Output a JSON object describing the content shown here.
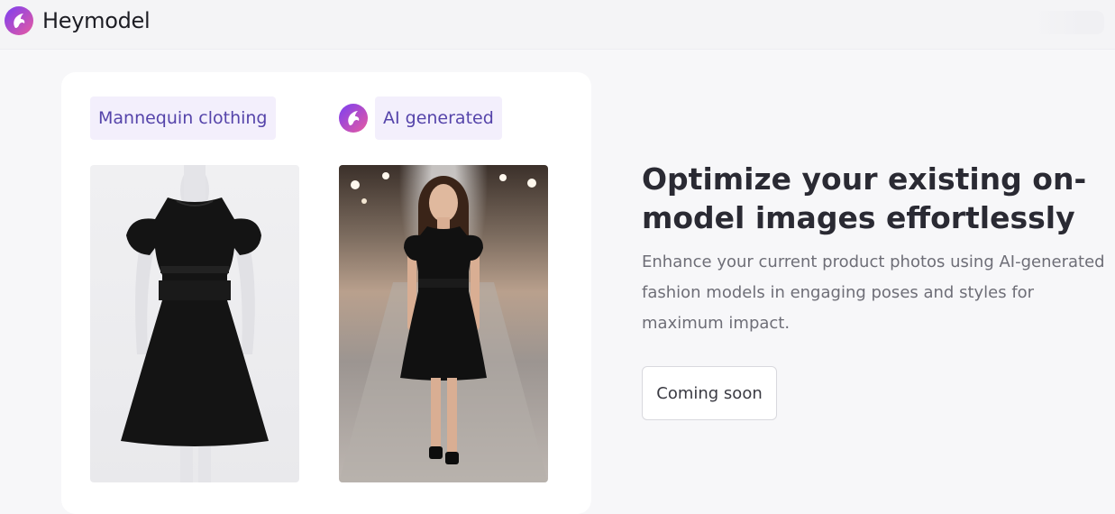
{
  "header": {
    "brand_name": "Heymodel",
    "logo_icon": "heymodel-logo-icon"
  },
  "comparison": {
    "left_label": "Mannequin clothing",
    "right_label": "AI generated",
    "left_image": "mannequin-black-dress-photo",
    "right_image": "ai-model-runway-black-dress-photo"
  },
  "feature": {
    "headline": "Optimize your existing on-model images effortlessly",
    "description": "Enhance your current product photos using AI-generated fashion models in engaging poses and styles for maximum impact.",
    "cta_label": "Coming soon"
  },
  "colors": {
    "brand_gradient_start": "#7b3ff2",
    "brand_gradient_end": "#e85aa0",
    "tag_background": "#f3effc",
    "tag_text": "#5544aa"
  }
}
